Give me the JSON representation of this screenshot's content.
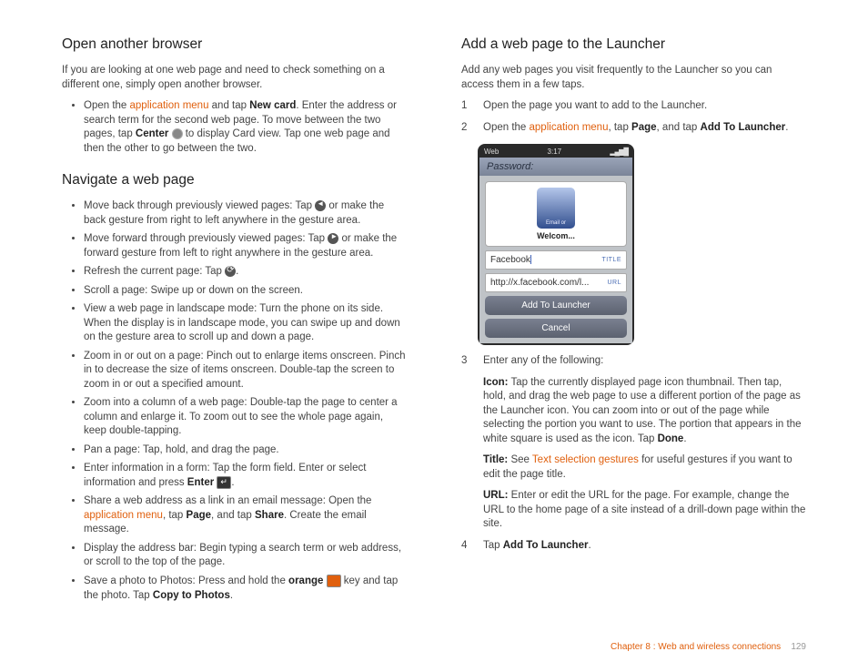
{
  "left": {
    "h1": "Open another browser",
    "p1": "If you are looking at one web page and need to check something on a different one, simply open another browser.",
    "b1a": "Open the ",
    "b1link": "application menu",
    "b1b": " and tap ",
    "b1bold1": "New card",
    "b1c": ". Enter the address or search term for the second web page. To move between the two pages, tap ",
    "b1bold2": "Center",
    "b1d": " to display Card view. Tap one web page and then the other to go between the two.",
    "h2": "Navigate a web page",
    "n1a": "Move back through previously viewed pages: Tap ",
    "n1b": " or make the back gesture from right to left anywhere in the gesture area.",
    "n2a": "Move forward through previously viewed pages: Tap ",
    "n2b": " or make the forward gesture from left to right anywhere in the gesture area.",
    "n3a": "Refresh the current page: Tap ",
    "n3b": ".",
    "n4": "Scroll a page: Swipe up or down on the screen.",
    "n5": "View a web page in landscape mode: Turn the phone on its side. When the display is in landscape mode, you can swipe up and down on the gesture area to scroll up and down a page.",
    "n6": "Zoom in or out on a page: Pinch out to enlarge items onscreen. Pinch in to decrease the size of items onscreen. Double-tap the screen to zoom in or out a specified amount.",
    "n7": "Zoom into a column of a web page: Double-tap the page to center a column and enlarge it. To zoom out to see the whole page again, keep double-tapping.",
    "n8": "Pan a page: Tap, hold, and drag the page.",
    "n9a": "Enter information in a form: Tap the form field. Enter or select information and press ",
    "n9bold": "Enter",
    "n9b": ".",
    "n10a": "Share a web address as a link in an email message: Open the ",
    "n10link": "application menu",
    "n10b": ", tap ",
    "n10bold1": "Page",
    "n10c": ", and tap ",
    "n10bold2": "Share",
    "n10d": ". Create the email message.",
    "n11": "Display the address bar: Begin typing a search term or web address, or scroll to the top of the page.",
    "n12a": "Save a photo to Photos: Press and hold the ",
    "n12bold1": "orange",
    "n12b": " key and tap the photo. Tap ",
    "n12bold2": "Copy to Photos",
    "n12c": "."
  },
  "right": {
    "h1": "Add a web page to the Launcher",
    "p1": "Add any web pages you visit frequently to the Launcher so you can access them in a few taps.",
    "s1": "Open the page you want to add to the Launcher.",
    "s2a": "Open the ",
    "s2link": "application menu",
    "s2b": ", tap ",
    "s2bold1": "Page",
    "s2c": ", and tap ",
    "s2bold2": "Add To Launcher",
    "s2d": ".",
    "phone": {
      "web": "Web",
      "time": "3:17",
      "password": "Password:",
      "thumb": "Email or",
      "welcom": "Welcom...",
      "title_val": "Facebook",
      "title_tag": "TITLE",
      "url_val": "http://x.facebook.com/l...",
      "url_tag": "URL",
      "btn1": "Add To Launcher",
      "btn2": "Cancel"
    },
    "s3": "Enter any of the following:",
    "iconLabel": "Icon:",
    "iconText": " Tap the currently displayed page icon thumbnail. Then tap, hold, and drag the web page to use a different portion of the page as the Launcher icon. You can zoom into or out of the page while selecting the portion you want to use. The portion that appears in the white square is used as the icon. Tap ",
    "iconBold": "Done",
    "iconEnd": ".",
    "titleLabel": "Title:",
    "titleText1": " See ",
    "titleLink": "Text selection gestures",
    "titleText2": " for useful gestures if you want to edit the page title.",
    "urlLabel": "URL:",
    "urlText": " Enter or edit the URL for the page. For example, change the URL to the home page of a site instead of a drill-down page within the site.",
    "s4a": "Tap ",
    "s4bold": "Add To Launcher",
    "s4b": "."
  },
  "footer": {
    "chapter": "Chapter 8  :  Web and wireless connections",
    "page": "129"
  }
}
